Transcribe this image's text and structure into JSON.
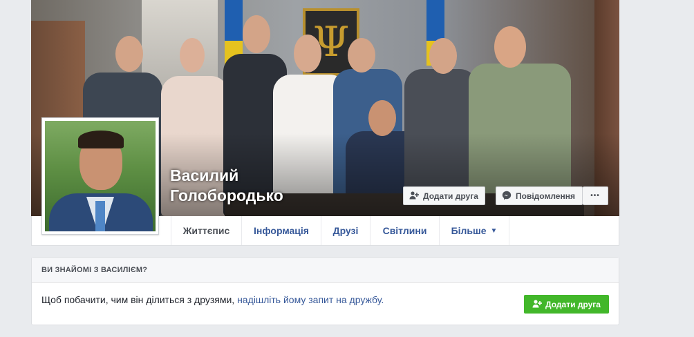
{
  "profile": {
    "name_line1": "Василий",
    "name_line2": "Голобородько"
  },
  "cover_actions": {
    "add_friend_label": "Додати друга",
    "add_friend_icon": "add-friend-icon",
    "message_label": "Повідомлення",
    "message_icon": "messenger-icon",
    "more_label": "•••"
  },
  "tabs": [
    {
      "label": "Життєпис"
    },
    {
      "label": "Інформація"
    },
    {
      "label": "Друзі"
    },
    {
      "label": "Світлини"
    },
    {
      "label": "Більше",
      "caret": "▼"
    }
  ],
  "know_card": {
    "heading": "ВИ ЗНАЙОМІ З ВАСИЛІЄМ?",
    "text_prefix": "Щоб побачити, чим він ділиться з друзями, ",
    "text_link": "надішліть йому запит на дружбу.",
    "button_label": "Додати друга"
  },
  "colors": {
    "link": "#365899",
    "green": "#42b72a",
    "page_bg": "#e9ebee"
  }
}
